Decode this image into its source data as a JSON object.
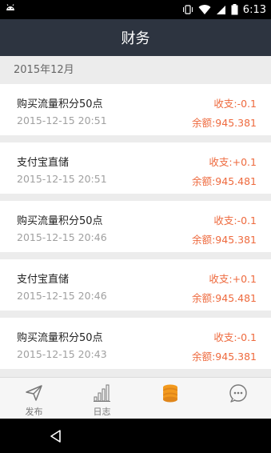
{
  "status_bar": {
    "time": "6:13"
  },
  "header": {
    "title": "财务"
  },
  "section": {
    "label": "2015年12月"
  },
  "records": [
    {
      "title": "购买流量积分50点",
      "time": "2015-12-15 20:51",
      "delta": "收支:-0.1",
      "balance": "余额:945.381"
    },
    {
      "title": "支付宝直储",
      "time": "2015-12-15 20:51",
      "delta": "收支:+0.1",
      "balance": "余额:945.481"
    },
    {
      "title": "购买流量积分50点",
      "time": "2015-12-15 20:46",
      "delta": "收支:-0.1",
      "balance": "余额:945.381"
    },
    {
      "title": "支付宝直储",
      "time": "2015-12-15 20:46",
      "delta": "收支:+0.1",
      "balance": "余额:945.481"
    },
    {
      "title": "购买流量积分50点",
      "time": "2015-12-15 20:43",
      "delta": "收支:-0.1",
      "balance": "余额:945.381"
    }
  ],
  "bottom_nav": {
    "items": [
      {
        "label": "发布",
        "icon": "paper-plane-icon"
      },
      {
        "label": "日志",
        "icon": "bar-chart-icon"
      },
      {
        "label": "",
        "icon": "coins-stack-icon"
      },
      {
        "label": "",
        "icon": "more-chat-icon"
      }
    ]
  },
  "colors": {
    "header_bg": "#2d3440",
    "accent": "#ee6a3e",
    "coins_accent": "#f39a1e"
  }
}
